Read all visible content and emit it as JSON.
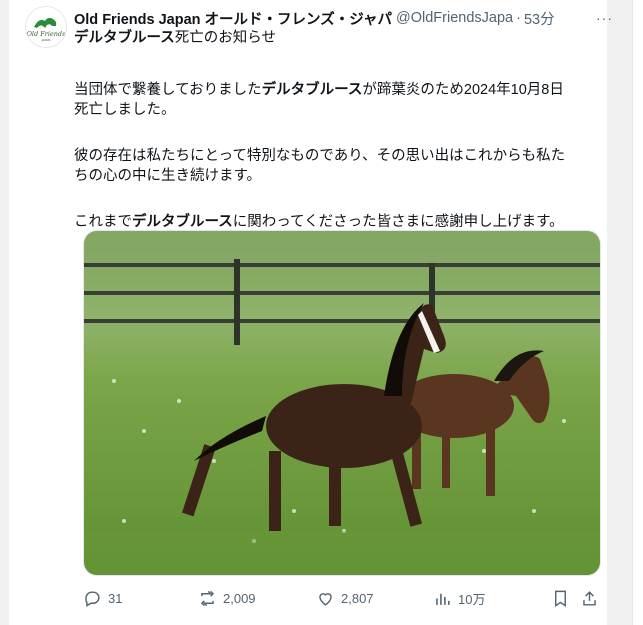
{
  "post": {
    "author_name": "Old Friends Japan オールド・フレンズ・ジャパ",
    "handle": "@OldFriendsJapa",
    "time": "53分",
    "more": "···",
    "logo": {
      "line1": "Old Friends",
      "line2": "JAPAN"
    },
    "title_bold": "デルタブルース",
    "title_rest": "死亡のお知らせ",
    "p1_a": "当団体で繋養しておりました",
    "p1_bold": "デルタブルース",
    "p1_b": "が蹄葉炎のため2024年10月8日",
    "p1_c": "死亡しました。",
    "p2_a": "彼の存在は私たちにとって特別なものであり、その思い出はこれからも私た",
    "p2_b": "ちの心の中に生き続けます。",
    "p3_a": "これまで",
    "p3_bold": "デルタブルース",
    "p3_b": "に関わってくださった皆さまに感謝申し上げます。"
  },
  "actions": {
    "replies": "31",
    "reposts": "2,009",
    "likes": "2,807",
    "views": "10万"
  },
  "icons": [
    "reply-icon",
    "repost-icon",
    "like-icon",
    "views-icon",
    "bookmark-icon",
    "share-icon",
    "more-icon"
  ],
  "colors": {
    "muted": "#536471",
    "grass": "#6f9a3a"
  }
}
